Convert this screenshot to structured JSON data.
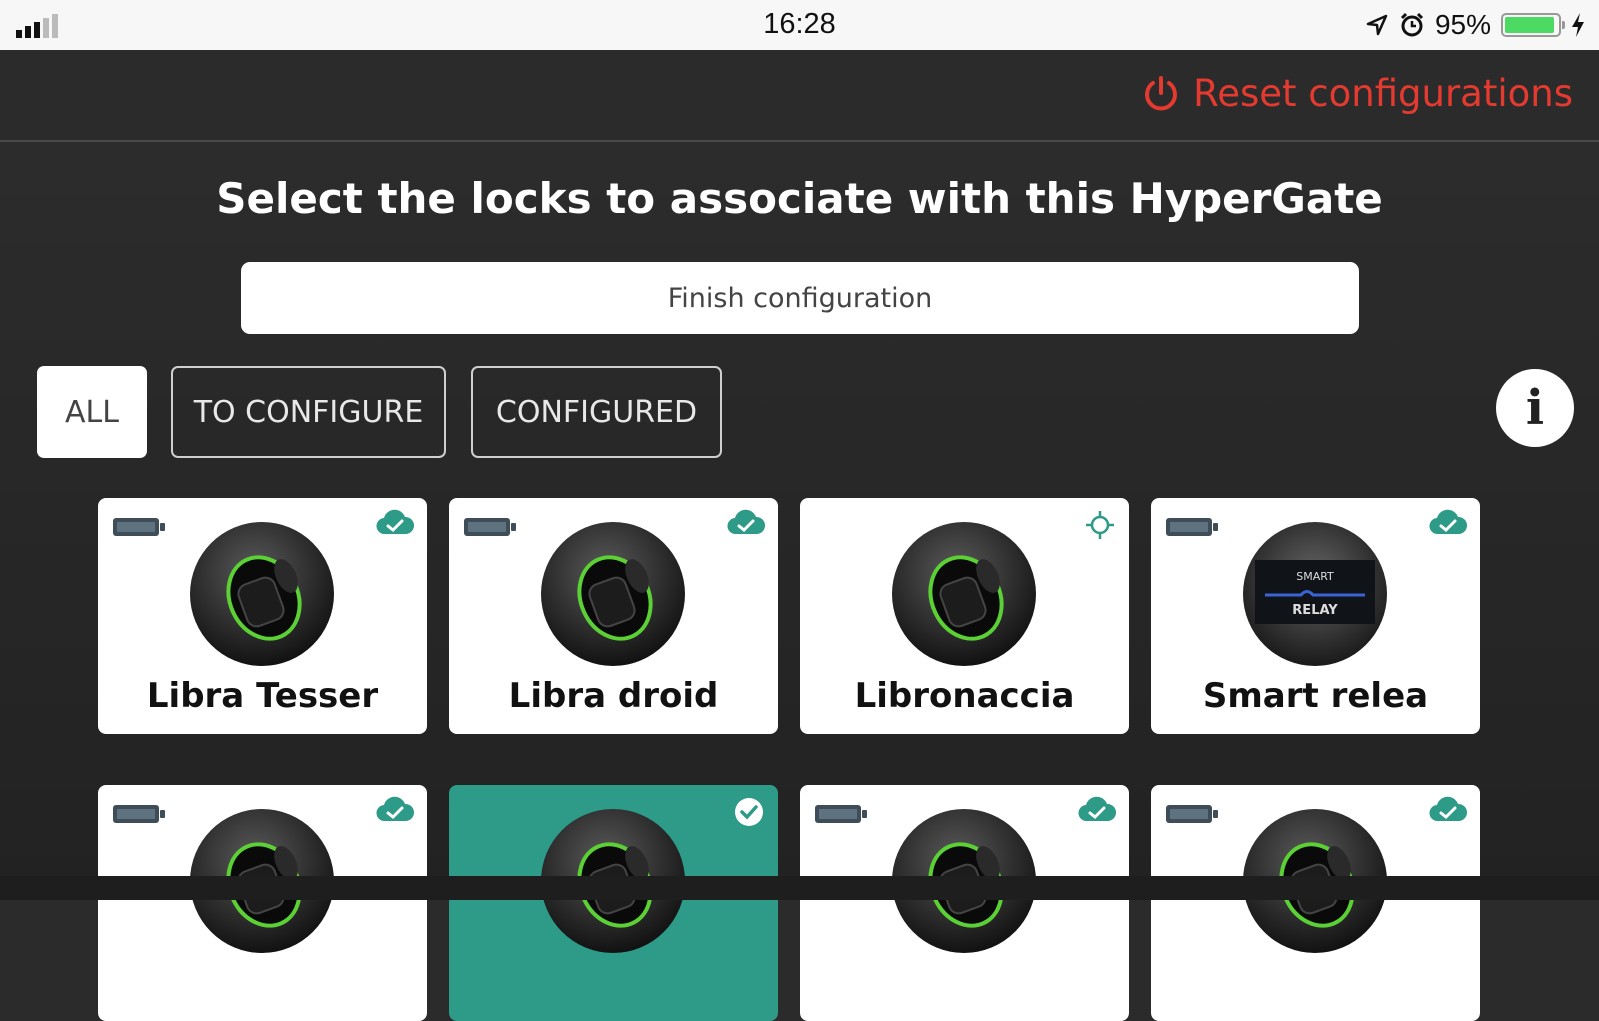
{
  "status_bar": {
    "time": "16:28",
    "battery_percent": "95%",
    "battery_level": 0.95,
    "icons": [
      "signal-icon",
      "location-arrow-icon",
      "alarm-icon",
      "battery-icon",
      "charging-bolt-icon"
    ]
  },
  "header": {
    "reset_label": "Reset configurations",
    "reset_icon": "power-icon",
    "accent_color": "#e43a2f"
  },
  "main": {
    "title": "Select the locks to associate with this HyperGate",
    "finish_label": "Finish configuration",
    "filters": [
      {
        "label": "ALL",
        "active": true
      },
      {
        "label": "TO CONFIGURE",
        "active": false
      },
      {
        "label": "CONFIGURED",
        "active": false
      }
    ],
    "info_label": "i"
  },
  "locks": [
    {
      "name": "Libra Tesser",
      "status": "cloud-check-icon",
      "battery": true,
      "image": "cylinder-lock"
    },
    {
      "name": "Libra droid",
      "status": "cloud-check-icon",
      "battery": true,
      "image": "cylinder-lock"
    },
    {
      "name": "Libronaccia",
      "status": "target-icon",
      "battery": false,
      "image": "cylinder-lock"
    },
    {
      "name": "Smart relea",
      "status": "cloud-check-icon",
      "battery": true,
      "image": "smart-relay"
    },
    {
      "name": "",
      "status": "cloud-check-icon",
      "battery": true,
      "image": "cylinder-lock"
    },
    {
      "name": "",
      "status": "selected-check-icon",
      "battery": false,
      "image": "cylinder-lock",
      "selected": true
    },
    {
      "name": "",
      "status": "cloud-check-icon",
      "battery": true,
      "image": "cylinder-lock"
    },
    {
      "name": "",
      "status": "cloud-check-icon",
      "battery": true,
      "image": "cylinder-lock"
    }
  ],
  "relay_image_text": {
    "top": "SMART",
    "bottom": "RELAY"
  },
  "colors": {
    "selected_card": "#2e9a88",
    "cloud_icon": "#2e9a88",
    "lock_ring": "#5bd135"
  }
}
